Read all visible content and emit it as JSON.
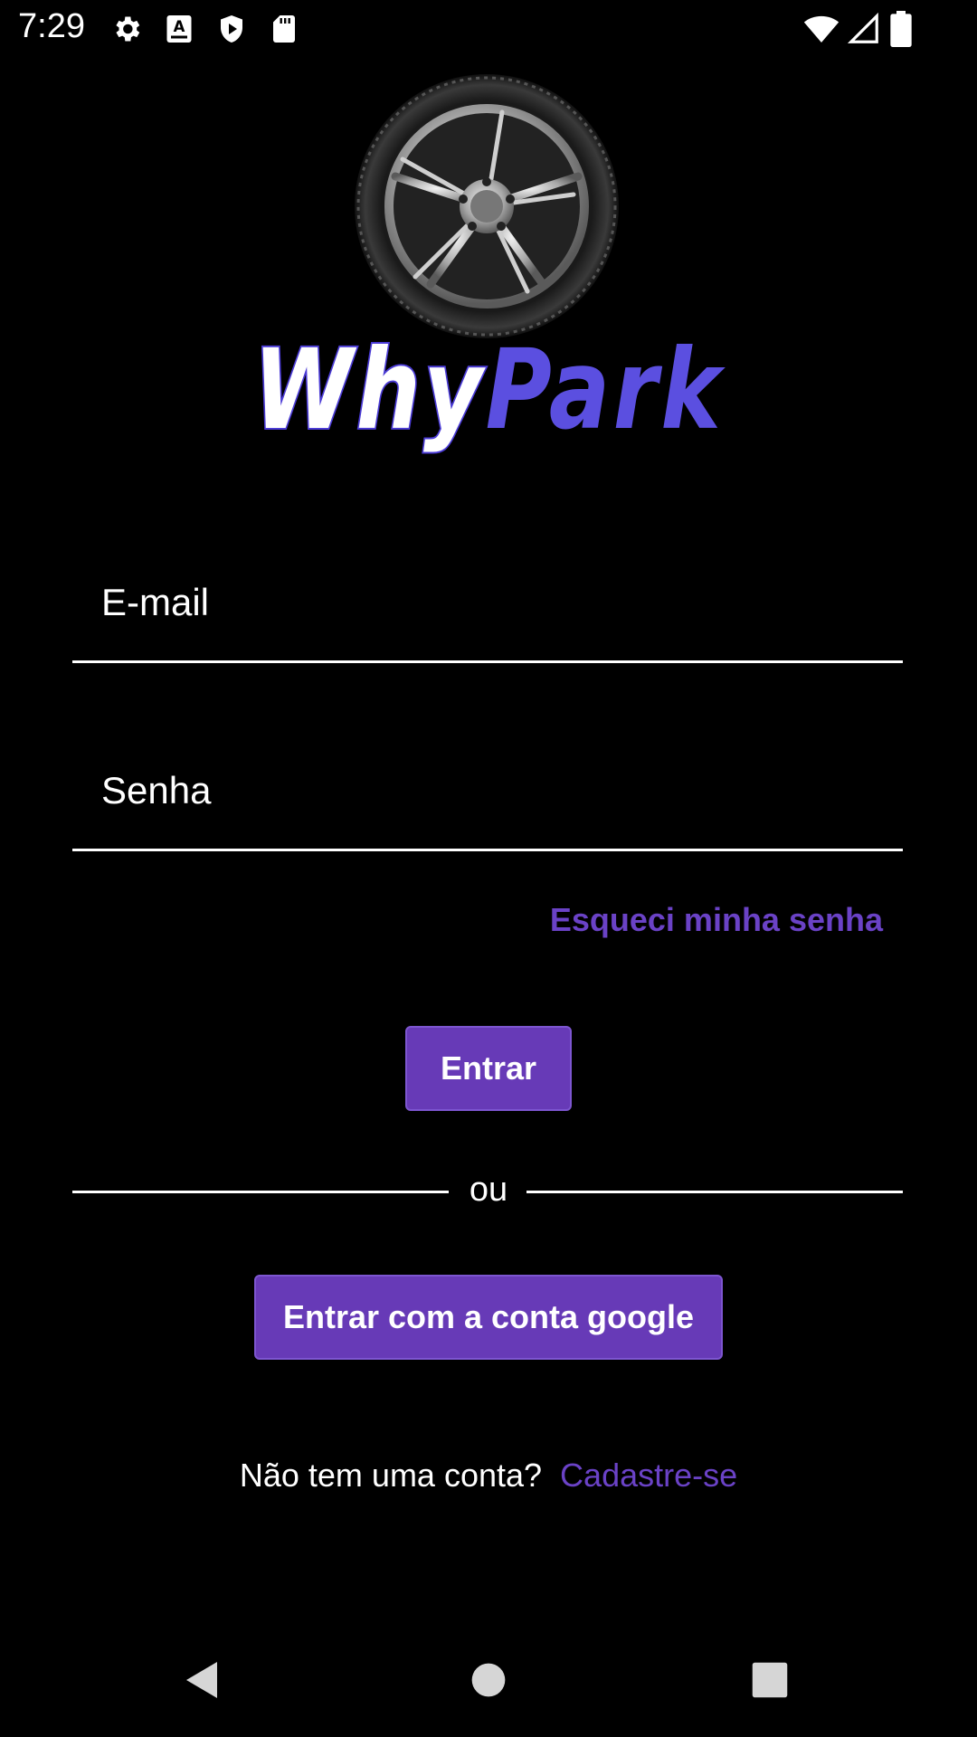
{
  "status_bar": {
    "time": "7:29",
    "left_icons": [
      "gear-icon",
      "a-keyboard-icon",
      "shield-play-icon",
      "sd-card-icon"
    ],
    "right_icons": [
      "wifi-icon",
      "signal-icon",
      "battery-icon"
    ]
  },
  "logo": {
    "icon": "wheel-icon",
    "brand_part1": "Why",
    "brand_part2": "Park"
  },
  "form": {
    "email_placeholder": "E-mail",
    "email_value": "",
    "password_placeholder": "Senha",
    "password_value": "",
    "forgot_label": "Esqueci minha senha",
    "login_label": "Entrar",
    "divider_label": "ou",
    "google_label": "Entrar com a conta google",
    "signup_question": "Não tem uma conta?",
    "signup_link": "Cadastre-se"
  },
  "nav_bar": {
    "items": [
      "back-icon",
      "home-icon",
      "recents-icon"
    ]
  },
  "colors": {
    "background": "#000000",
    "accent": "#673ab7",
    "link": "#6a42c6",
    "brand_blue": "#5b4fe0"
  }
}
